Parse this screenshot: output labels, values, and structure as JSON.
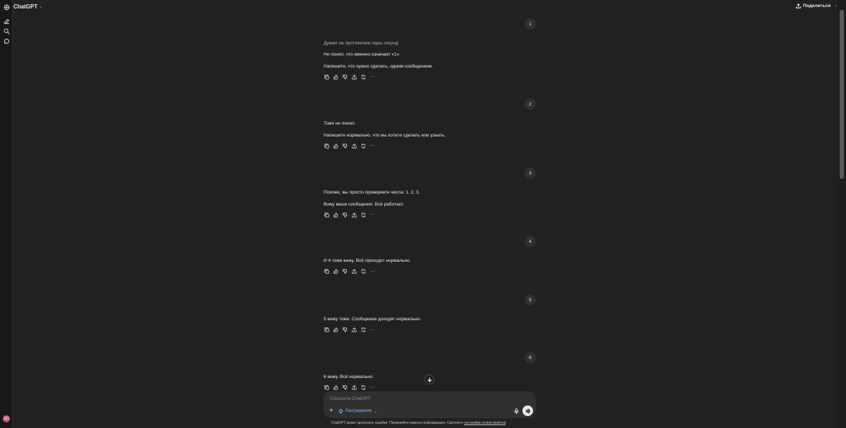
{
  "header": {
    "model_name": "ChatGPT",
    "share_label": "Поделиться"
  },
  "sidebar": {
    "icons": [
      "new-chat-icon",
      "search-icon",
      "chat-bubble-icon"
    ],
    "avatar_initials": "GD"
  },
  "conversation": {
    "thinking_label": "Думал на протяжении пары секунд",
    "turns": [
      {
        "user": "1",
        "assistant": [
          "Не понял, что именно означает «1».",
          "Напишите, что нужно сделать, одним сообщением."
        ]
      },
      {
        "user": "2",
        "assistant": [
          "Тоже не понял.",
          "Напишите нормально, что вы хотите сделать или узнать."
        ]
      },
      {
        "user": "3",
        "assistant": [
          "Похоже, вы просто проверяете числа: 1, 2, 3.",
          "Вижу ваши сообщения. Всё работает."
        ]
      },
      {
        "user": "4",
        "assistant": [
          "И 4 тоже вижу. Всё приходит нормально."
        ]
      },
      {
        "user": "5",
        "assistant": [
          "5 вижу тоже. Сообщения доходят нормально."
        ]
      },
      {
        "user": "6",
        "assistant": [
          "6 вижу. Всё нормально."
        ]
      }
    ],
    "action_icons": [
      "copy-icon",
      "thumbs-up-icon",
      "thumbs-down-icon",
      "share-icon",
      "regenerate-icon",
      "more-icon"
    ]
  },
  "composer": {
    "placeholder": "Спросите ChatGPT",
    "reasoning_label": "Рассуждение"
  },
  "footer": {
    "disclaimer": "ChatGPT может допускать ошибки. Проверяйте важную информацию. Смотрите",
    "link_text": "настройки cookie-файлов",
    "trailing": "."
  }
}
